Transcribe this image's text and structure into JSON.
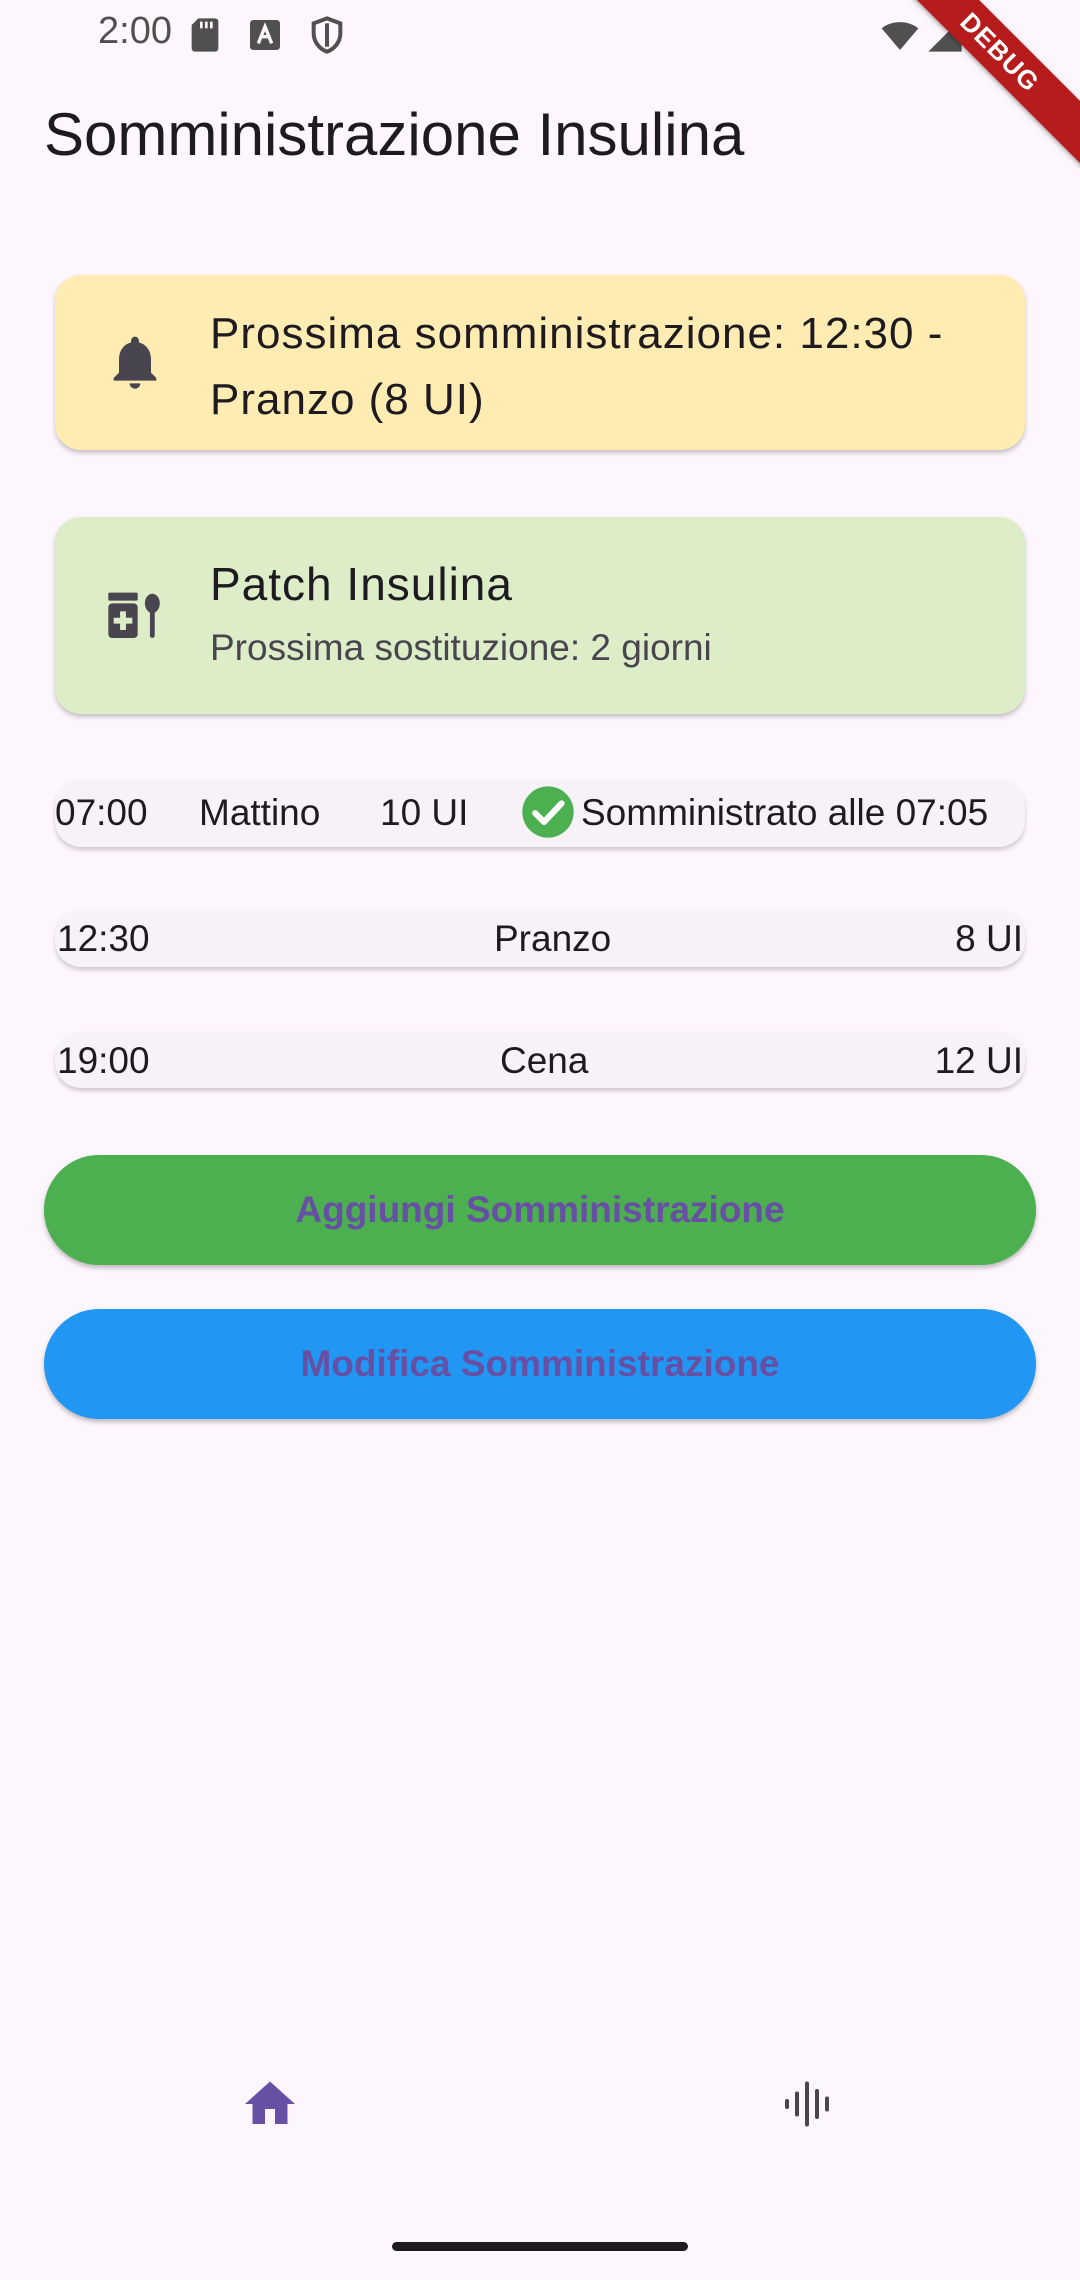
{
  "status_bar": {
    "time": "2:00",
    "icons": [
      "sd-card-icon",
      "text-a-icon",
      "shield-icon",
      "wifi-icon",
      "signal-icon",
      "battery-icon"
    ]
  },
  "debug_banner": "DEBUG",
  "app_bar": {
    "title": "Somministrazione Insulina"
  },
  "reminder_card": {
    "icon": "bell-icon",
    "text": "Prossima somministrazione: 12:30 - Pranzo (8 UI)",
    "color": "#FFECB3"
  },
  "patch_card": {
    "icon": "medication-icon",
    "title": "Patch Insulina",
    "subtitle": "Prossima sostituzione: 2 giorni",
    "color": "#DCEDC8"
  },
  "schedule": [
    {
      "time": "07:00",
      "meal": "Mattino",
      "dose": "10 UI",
      "status_icon": "check-circle-icon",
      "status": "Somministrato alle 07:05"
    },
    {
      "time": "12:30",
      "meal": "Pranzo",
      "dose": "8 UI"
    },
    {
      "time": "19:00",
      "meal": "Cena",
      "dose": "12 UI"
    }
  ],
  "buttons": {
    "add": {
      "label": "Aggiungi Somministrazione",
      "color": "#4CAF50"
    },
    "edit": {
      "label": "Modifica Somministrazione",
      "color": "#2196F3"
    }
  },
  "bottom_nav": {
    "items": [
      {
        "icon": "home-icon",
        "selected": true
      },
      {
        "icon": "voice-icon",
        "selected": false
      }
    ]
  },
  "colors": {
    "background": "#FDF6FC",
    "primary": "#6750A4",
    "success": "#4CAF50"
  }
}
